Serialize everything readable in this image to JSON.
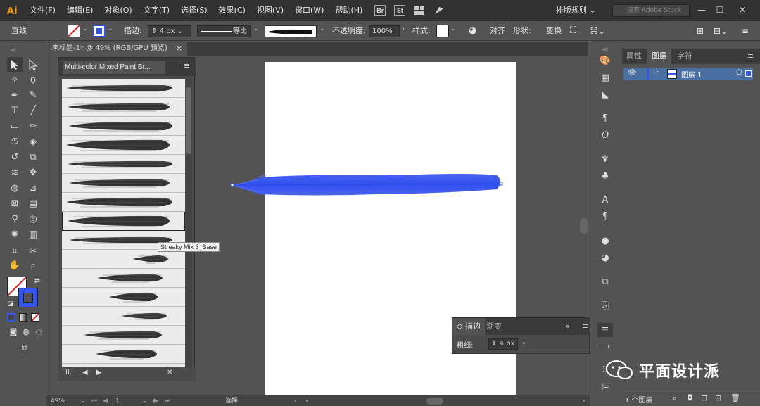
{
  "app": {
    "logo": "Ai"
  },
  "menu": [
    "文件(F)",
    "编辑(E)",
    "对象(O)",
    "文字(T)",
    "选择(S)",
    "效果(C)",
    "视图(V)",
    "窗口(W)",
    "帮助(H)"
  ],
  "top_badges": [
    "Br",
    "St"
  ],
  "workspace": "排版规则",
  "stock_search_placeholder": "搜索 Adobe Stock",
  "window_buttons": [
    "—",
    "☐",
    "✕"
  ],
  "control_bar": {
    "object_type": "直线",
    "stroke_label": "描边:",
    "stroke_value": "4 px",
    "profile_label": "等比",
    "opacity_label": "不透明度:",
    "opacity_value": "100%",
    "style_label": "样式:",
    "align_label": "对齐",
    "shape_label": "形状:",
    "transform_label": "变换"
  },
  "document_tab": {
    "title": "未标题-1* @ 49% (RGB/GPU 预览)",
    "close": "×"
  },
  "brush_panel": {
    "title": "Multi-color Mixed Paint Br...",
    "brush_count": 15,
    "selected_index": 7,
    "tooltip": "Streaky Mix 3_Base"
  },
  "stroke_panel": {
    "tabs": [
      "描边",
      "渐变"
    ],
    "weight_label": "粗细:",
    "weight_value": "4 px"
  },
  "layers_panel": {
    "tabs": [
      "属性",
      "图层",
      "字符"
    ],
    "active_tab": 1,
    "layer_name": "图层 1",
    "footer_count": "1 个图层"
  },
  "status_bar": {
    "zoom": "49%",
    "page": "1",
    "tool": "选择"
  },
  "watermark": "平面设计派",
  "colors": {
    "stroke_blue": "#3355ee",
    "accent_orange": "#ff9a00",
    "layer_selection": "#4a6fa0"
  },
  "icons": {
    "tools": [
      "selection-tool-icon",
      "direct-selection-tool-icon",
      "magic-wand-tool-icon",
      "lasso-tool-icon",
      "pen-tool-icon",
      "curvature-tool-icon",
      "type-tool-icon",
      "line-segment-tool-icon",
      "rectangle-tool-icon",
      "paintbrush-tool-icon",
      "shaper-tool-icon",
      "eraser-tool-icon",
      "rotate-tool-icon",
      "scale-tool-icon",
      "width-tool-icon",
      "free-transform-tool-icon",
      "shape-builder-tool-icon",
      "perspective-grid-tool-icon",
      "mesh-tool-icon",
      "gradient-tool-icon",
      "eyedropper-tool-icon",
      "blend-tool-icon",
      "symbol-sprayer-tool-icon",
      "column-graph-tool-icon",
      "artboard-tool-icon",
      "slice-tool-icon",
      "hand-tool-icon",
      "zoom-tool-icon"
    ]
  }
}
